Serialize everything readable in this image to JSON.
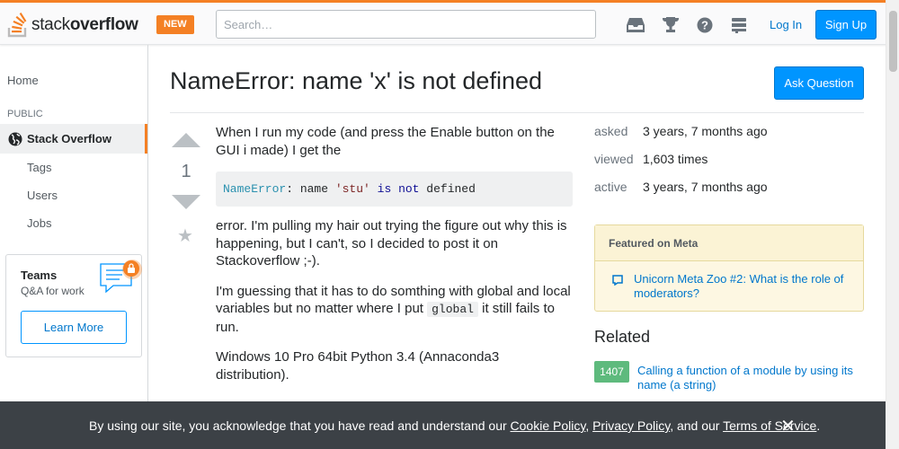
{
  "header": {
    "logo_prefix": "stack",
    "logo_bold": "overflow",
    "new_badge": "NEW",
    "search_placeholder": "Search…",
    "login_label": "Log In",
    "signup_label": "Sign Up",
    "icons": [
      "inbox-icon",
      "trophy-icon",
      "help-icon",
      "site-switcher-icon"
    ]
  },
  "sidebar": {
    "home": "Home",
    "public_header": "PUBLIC",
    "stack_overflow": "Stack Overflow",
    "sub_items": [
      "Tags",
      "Users",
      "Jobs"
    ],
    "teams": {
      "title": "Teams",
      "subtitle": "Q&A for work",
      "button": "Learn More"
    }
  },
  "question": {
    "title": "NameError: name 'x' is not defined",
    "ask_button": "Ask Question",
    "votes": "1",
    "body_intro": "When I run my code (and press the Enable button on the GUI i made) I get the",
    "code": {
      "type": "NameError",
      "colon": ": name ",
      "str": "'stu'",
      "is": "is",
      "not": "not",
      "defined": "defined"
    },
    "para2": "error. I'm pulling my hair out trying the figure out why this is happening, but I can't, so I decided to post it on Stackoverflow ;-).",
    "para3_before": "I'm guessing that it has to do somthing with global and local variables but no matter where I put ",
    "para3_code": "global",
    "para3_after": " it still fails to run.",
    "para4": "Windows 10 Pro 64bit Python 3.4 (Annaconda3 distribution)."
  },
  "meta": {
    "asked_label": "asked",
    "asked_value": "3 years, 7 months ago",
    "viewed_label": "viewed",
    "viewed_value": "1,603 times",
    "active_label": "active",
    "active_value": "3 years, 7 months ago"
  },
  "featured": {
    "header": "Featured on Meta",
    "item": "Unicorn Meta Zoo #2: What is the role of moderators?"
  },
  "related": {
    "header": "Related",
    "items": [
      {
        "score": "1407",
        "title": "Calling a function of a module by using its name (a string)"
      }
    ]
  },
  "cookie": {
    "text1": "By using our site, you acknowledge that you have read and understand our ",
    "cookie_policy": "Cookie Policy",
    "comma": ", ",
    "privacy_policy": "Privacy Policy",
    "and_our": ", and our ",
    "terms": "Terms of Service",
    "period": "."
  },
  "colors": {
    "accent": "#f48024",
    "primary": "#0095ff",
    "link": "#0077cc",
    "score_green": "#5eba7d"
  }
}
